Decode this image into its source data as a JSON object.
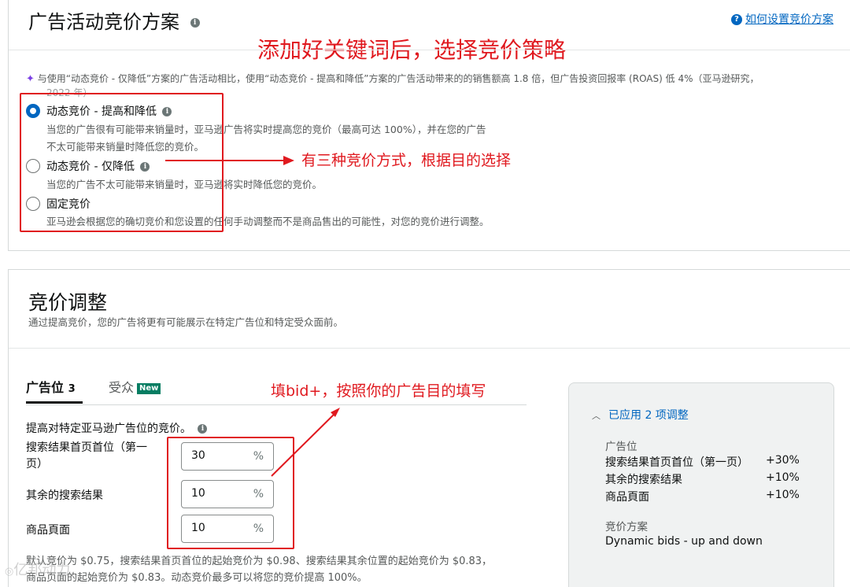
{
  "card1": {
    "title": "广告活动竞价方案",
    "help_link": "如何设置竞价方案",
    "annotation_top": "添加好关键词后，选择竞价策略",
    "tip_line1": "与使用“动态竞价 - 仅降低”方案的广告活动相比，使用“动态竞价 - 提高和降低”方案的广告活动带来的的销售额高 1.8 倍，但广告投资回报率 (ROAS) 低 4%（亚马逊研究，",
    "tip_line2": "2022 年）",
    "options": [
      {
        "label": "动态竞价 - 提高和降低",
        "desc1": "当您的广告很有可能带来销量时，亚马逊广告将实时提高您的竞价（最高可达 100%），并在您的广告",
        "desc2": "不太可能带来销量时降低您的竞价。",
        "checked": true
      },
      {
        "label": "动态竞价 - 仅降低",
        "desc1": "当您的广告不太可能带来销量时，亚马逊将实时降低您的竞价。",
        "checked": false
      },
      {
        "label": "固定竞价",
        "desc1": "亚马逊会根据您的确切竞价和您设置的任何手动调整而不是商品售出的可能性，对您的竞价进行调整。",
        "checked": false
      }
    ],
    "annotation_mid": "有三种竞价方式，根据目的选择"
  },
  "card2": {
    "title": "竞价调整",
    "subtitle": "通过提高竞价，您的广告将更有可能展示在特定广告位和特定受众面前。",
    "tabs": [
      {
        "label": "广告位",
        "count": "3",
        "active": true
      },
      {
        "label": "受众",
        "badge": "New",
        "active": false
      }
    ],
    "annotation_bid": "填bid+，按照你的广告目的填写",
    "section_label": "提高对特定亚马逊广告位的竞价。",
    "placements": [
      {
        "label_line1": "搜索结果首页首位（第一",
        "label_line2": "页）",
        "value": "30",
        "unit": "%"
      },
      {
        "label_line1": "其余的搜索结果",
        "value": "10",
        "unit": "%"
      },
      {
        "label_line1": "商品頁面",
        "value": "10",
        "unit": "%"
      }
    ],
    "footer_line1": "默认竞价为 $0.75，搜索结果首页首位的起始竞价为 $0.98、搜索结果其余位置的起始竞价为 $0.83，",
    "footer_line2": "商品页面的起始竞价为 $0.83。动态竞价最多可以将您的竞价提高 100%。",
    "watermark": "亿邦动力"
  },
  "summary": {
    "header": "已应用 2 项调整",
    "placement_heading": "广告位",
    "rows": [
      {
        "name": "搜索结果首页首位（第一页）",
        "value": "+30%"
      },
      {
        "name": "其余的搜索结果",
        "value": "+10%"
      },
      {
        "name": "商品頁面",
        "value": "+10%"
      }
    ],
    "strategy_heading": "竞价方案",
    "strategy_value": "Dynamic bids - up and down"
  },
  "colors": {
    "accent": "#0066c0",
    "annotation": "#e0191f",
    "new_badge": "#067d62"
  }
}
